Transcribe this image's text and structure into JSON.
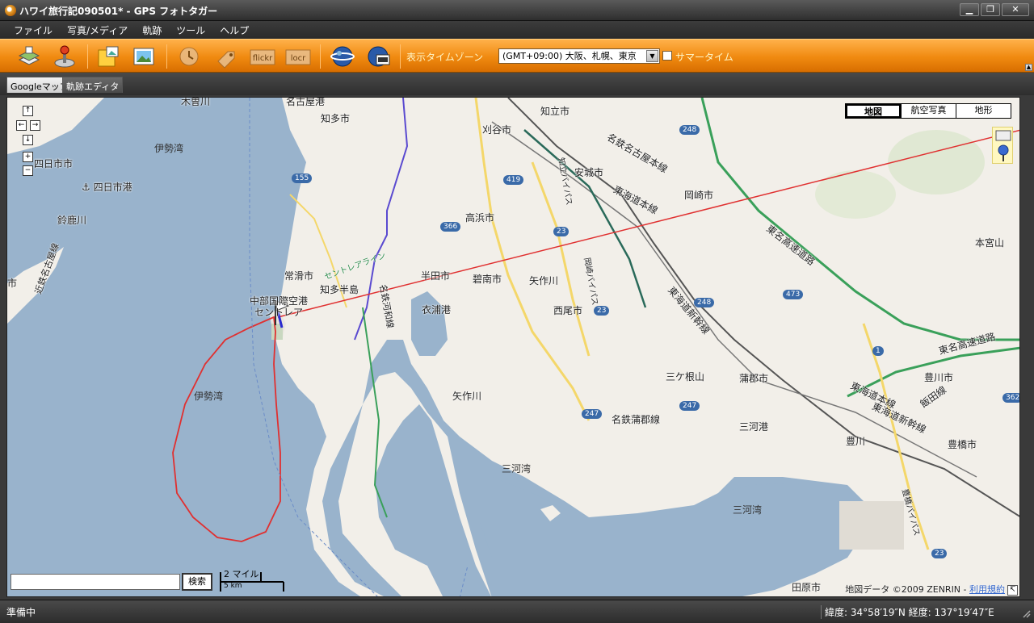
{
  "window": {
    "title": "ハワイ旅行記090501* - GPS フォトタガー",
    "minimize": "▁",
    "maximize": "❐",
    "close": "✕"
  },
  "menu": [
    "ファイル",
    "写真/メディア",
    "軌跡",
    "ツール",
    "ヘルプ"
  ],
  "toolbar": {
    "timezone_label": "表示タイムゾーン",
    "timezone_value": "(GMT+09:00) 大阪、札幌、東京",
    "dst_label": "サマータイム",
    "flickr": "flickr",
    "locr": "locr",
    "icons": [
      "layers-icon",
      "joystick-icon",
      "folder-photo-icon",
      "photo-icon",
      "clock-icon",
      "tag-icon",
      "flickr-icon",
      "locr-icon",
      "globe-icon",
      "globe-film-icon"
    ]
  },
  "tabs": [
    "Googleマップ",
    "軌跡エディタ"
  ],
  "map": {
    "types": [
      "地図",
      "航空写真",
      "地形"
    ],
    "nav": {
      "up": "↑",
      "left": "←",
      "right": "→",
      "down": "↓",
      "zoom_in": "+",
      "zoom_out": "−"
    },
    "search_button": "検索",
    "scale_miles": "2 マイル",
    "scale_km": "5 km",
    "copyright": "地図データ ©2009 ZENRIN - ",
    "terms_link": "利用規約",
    "labels": {
      "isewan1": "伊勢湾",
      "yokkaichi": "四日市市",
      "yokkaichi_port": "四日市港",
      "suzuka": "鈴鹿川",
      "chitashi": "知多市",
      "tokoname": "常滑市",
      "chitahanto": "知多半島",
      "chubu_airport": "中部国際空港",
      "centrair": "セントレア",
      "isewan2": "伊勢湾",
      "handa": "半田市",
      "hekinan": "碧南市",
      "kinuura": "衣浦港",
      "takahama": "高浜市",
      "kariya": "刈谷市",
      "chiryu": "知立市",
      "anjo": "安城市",
      "okazaki": "岡崎市",
      "nishio": "西尾市",
      "yahagi1": "矢作川",
      "yahagi2": "矢作川",
      "sangane": "三ケ根山",
      "gamagori": "蒲郡市",
      "mikawa_port": "三河港",
      "mikawawan1": "三河湾",
      "mikawawan2": "三河湾",
      "toyokawa_city": "豊川市",
      "toyokawa_river": "豊川",
      "toyohashi": "豊橋市",
      "tahara": "田原市",
      "honguyama": "本宮山",
      "meitetsu_nagoya": "名鉄名古屋本線",
      "tokaido1": "東海道本線",
      "tokaido2": "東海道本線",
      "tokaido_shinkansen": "東海道新幹線",
      "tokaido_shinkansen2": "東海道新幹線",
      "tomei": "東名高速道路",
      "tomei2": "東名高速道路",
      "meitetsu_gamagori": "名鉄蒲郡線",
      "iida": "飯田線",
      "kintetsu": "近鉄名古屋線",
      "kinuura_r": "名鉄河和線",
      "route155": "155",
      "route366": "366",
      "route419": "419",
      "route23a": "23",
      "route23b": "23",
      "route247a": "247",
      "route247b": "247",
      "route248a": "248",
      "route248b": "248",
      "route473": "473",
      "route1": "1",
      "route362": "362",
      "route23c": "23",
      "shi": "市",
      "nagoya": "名古屋港",
      "kisogawa": "木曽川",
      "chiryu_bypass": "知立バイパス",
      "okazaki_bypass": "岡崎バイパス",
      "centrair_line": "セントレアライン",
      "toyohashi_bypass": "豊橋バイパス"
    }
  },
  "status": {
    "text": "準備中",
    "coords": "緯度: 34°58′19″N  経度: 137°19′47″E"
  }
}
